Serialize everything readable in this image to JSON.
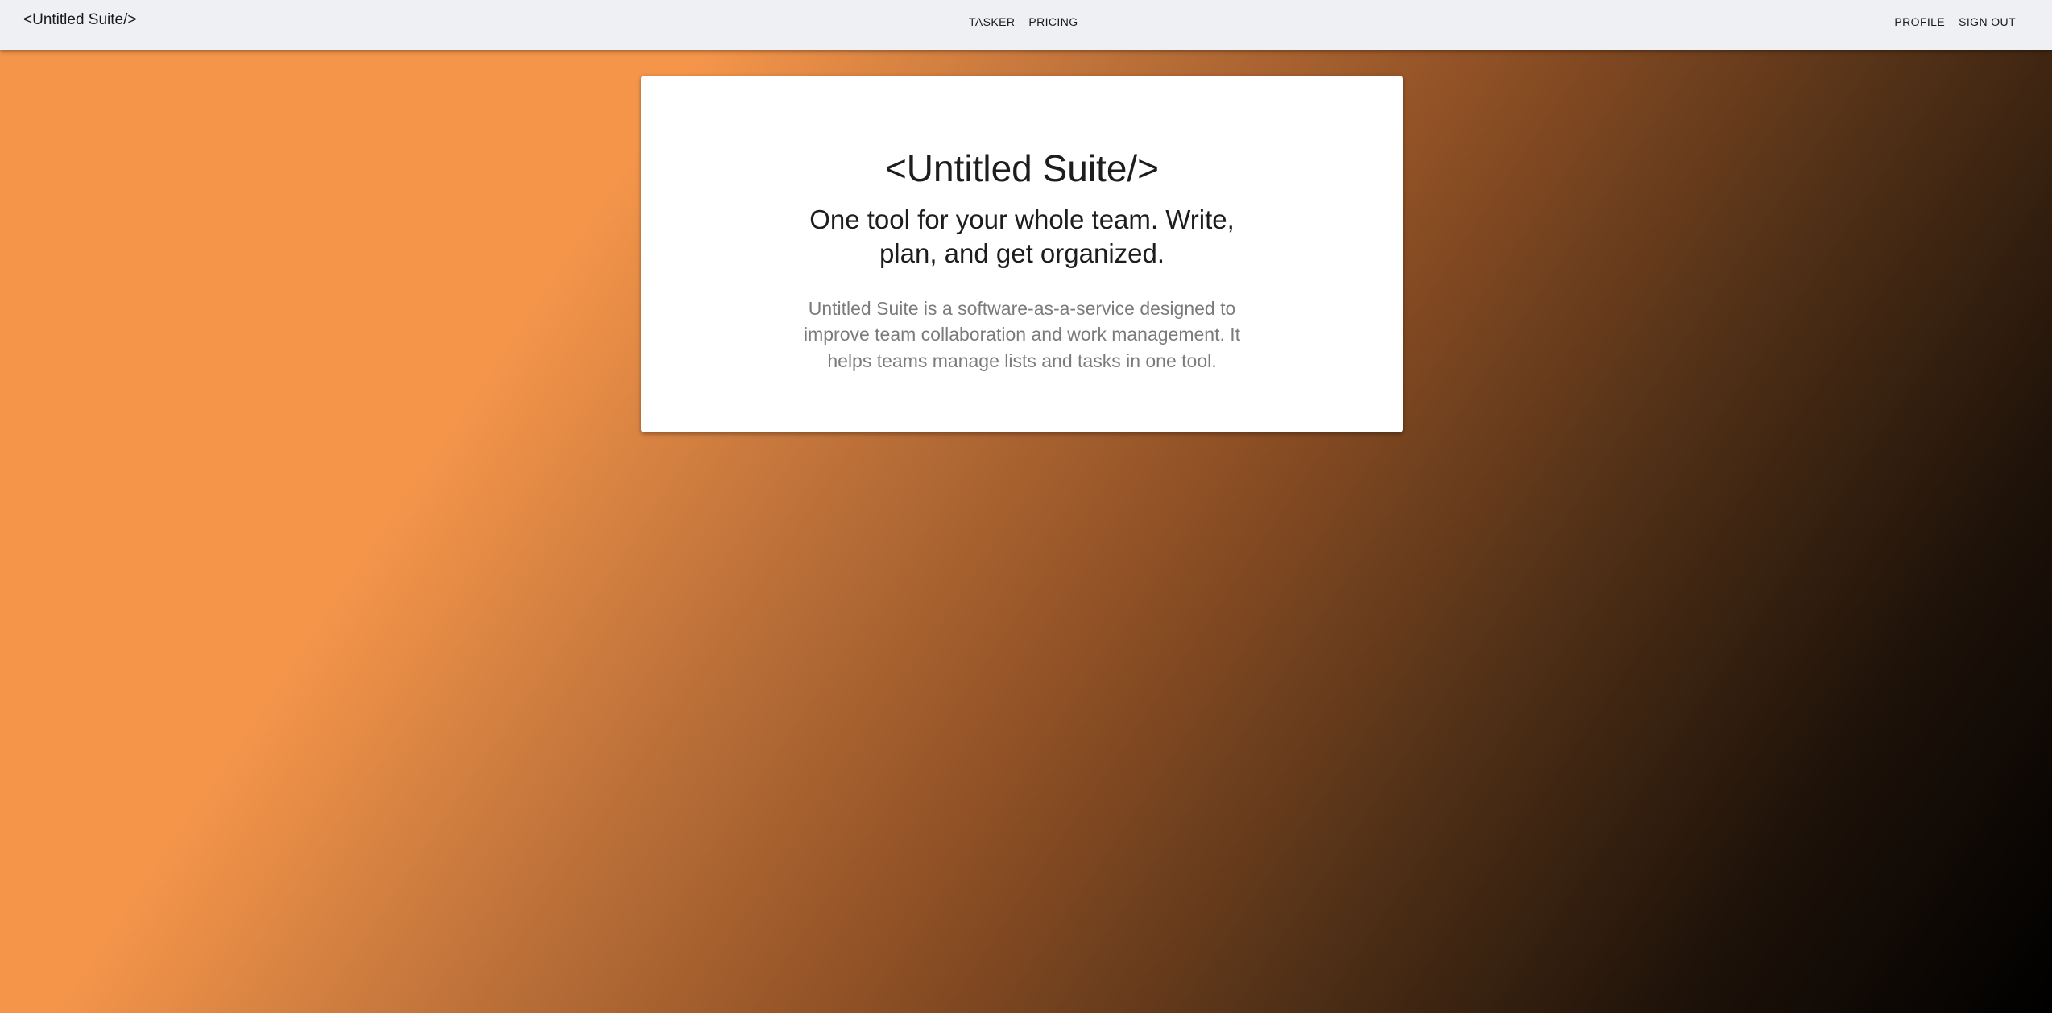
{
  "navbar": {
    "brand": "<Untitled Suite/>",
    "center_links": [
      {
        "label": "TASKER"
      },
      {
        "label": "PRICING"
      }
    ],
    "right_links": [
      {
        "label": "PROFILE"
      },
      {
        "label": "SIGN OUT"
      }
    ]
  },
  "hero": {
    "title": "<Untitled Suite/>",
    "subtitle": "One tool for your whole team. Write, plan, and get organized.",
    "description": "Untitled Suite is a software-as-a-service designed to improve team collaboration and work management. It helps teams manage lists and tasks in one tool."
  },
  "colors": {
    "navbar_bg": "#eef0f4",
    "gradient_start": "#f4954a",
    "gradient_end": "#000000",
    "card_bg": "#ffffff",
    "description_text": "#7b7b7b"
  }
}
